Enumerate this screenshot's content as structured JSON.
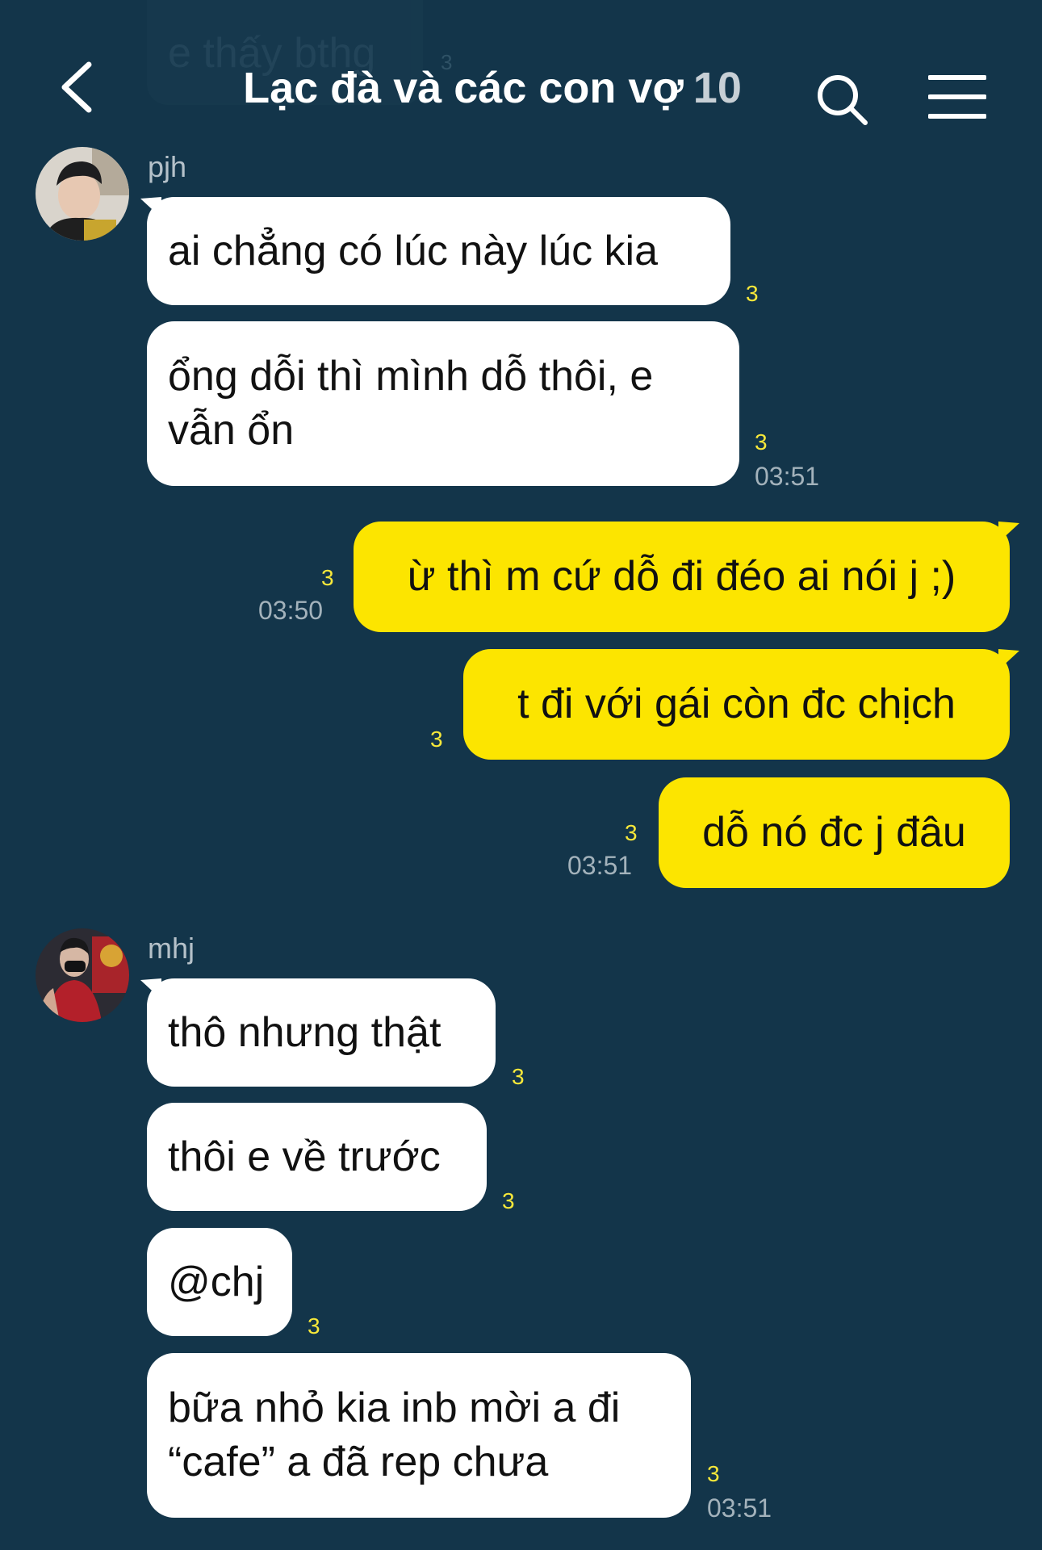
{
  "ghost": {
    "text": "e thấy bthg",
    "read": "3"
  },
  "header": {
    "title": "Lạc đà và các con vợ",
    "member_count": "10"
  },
  "colors": {
    "background": "#13354a",
    "incoming": "#ffffff",
    "outgoing": "#fce500",
    "read_count": "#f7e83a"
  },
  "messages": [
    {
      "sender": "pjh",
      "text": "ai chẳng có lúc này lúc kia",
      "read": "3"
    },
    {
      "line1": "ổng dỗi thì mình dỗ thôi, e",
      "line2": "vẫn ổn",
      "read": "3",
      "time": "03:51"
    },
    {
      "text": "ừ thì m cứ dỗ đi đéo ai nói j ;)",
      "read": "3",
      "time": "03:50"
    },
    {
      "text": "t đi với gái còn đc chịch",
      "read": "3"
    },
    {
      "text": "dỗ nó đc j đâu",
      "read": "3",
      "time": "03:51"
    },
    {
      "sender": "mhj",
      "text": "thô nhưng thật",
      "read": "3"
    },
    {
      "text": "thôi e về trước",
      "read": "3"
    },
    {
      "text": "@chj",
      "read": "3"
    },
    {
      "line1": "bữa nhỏ kia inb mời a đi",
      "line2": "“cafe” a đã rep chưa",
      "read": "3",
      "time": "03:51"
    }
  ]
}
